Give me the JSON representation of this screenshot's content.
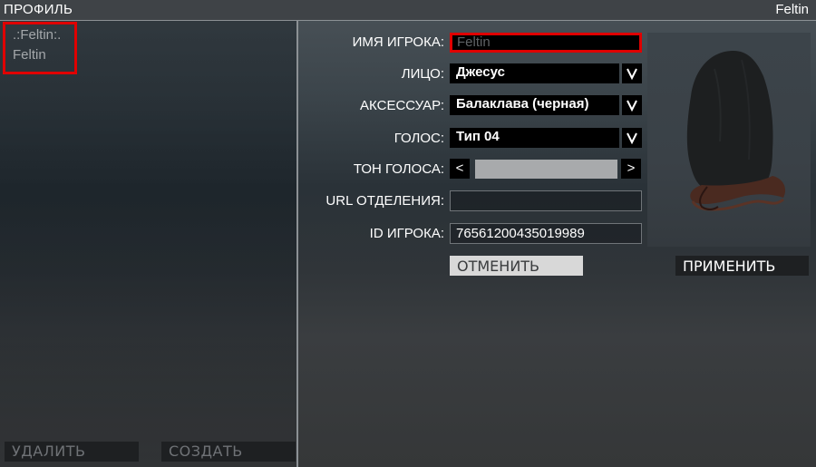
{
  "window": {
    "title": "ПРОФИЛЬ",
    "player_name": "Feltin"
  },
  "profiles": [
    {
      "label": ".:Feltin:."
    },
    {
      "label": "Feltin"
    }
  ],
  "left_buttons": {
    "delete": "УДАЛИТЬ",
    "create": "СОЗДАТЬ"
  },
  "form": {
    "name": {
      "label": "ИМЯ ИГРОКА:",
      "value": "Feltin"
    },
    "face": {
      "label": "ЛИЦО:",
      "value": "Джесус"
    },
    "accessory": {
      "label": "АКСЕССУАР:",
      "value": "Балаклава (черная)"
    },
    "voice": {
      "label": "ГОЛОС:",
      "value": "Тип 04"
    },
    "voice_pitch": {
      "label": "ТОН ГОЛОСА:",
      "left": "<",
      "right": ">"
    },
    "unit_url": {
      "label": "URL ОТДЕЛЕНИЯ:",
      "value": ""
    },
    "player_id": {
      "label": "ID ИГРОКА:",
      "value": "76561200435019989"
    }
  },
  "actions": {
    "cancel": "ОТМЕНИТЬ",
    "apply": "ПРИМЕНИТЬ"
  },
  "icons": {
    "dropdown": "chevron-down-icon",
    "preview": "balaclava-head-preview"
  },
  "colors": {
    "highlight": "#e00000",
    "panel_border": "#8c9195"
  }
}
